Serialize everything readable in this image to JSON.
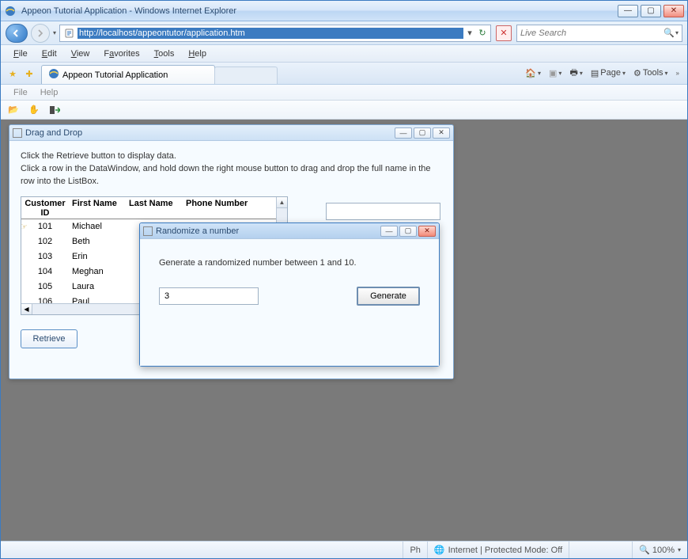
{
  "window": {
    "title": "Appeon Tutorial Application - Windows Internet Explorer"
  },
  "nav": {
    "address": "http://localhost/appeontutor/application.htm",
    "search_placeholder": "Live Search"
  },
  "ie_menu": {
    "file": "File",
    "edit": "Edit",
    "view": "View",
    "favorites": "Favorites",
    "tools": "Tools",
    "help": "Help"
  },
  "tab": {
    "label": "Appeon Tutorial Application"
  },
  "toolstrip": {
    "page": "Page",
    "tools": "Tools"
  },
  "app_menu": {
    "file": "File",
    "help": "Help"
  },
  "dragdrop": {
    "title": "Drag and Drop",
    "instr1": "Click the Retrieve button to display data.",
    "instr2": "Click a row in the DataWindow, and hold down the right mouse button to drag and drop the full name in the row into the ListBox.",
    "retrieve": "Retrieve",
    "columns": {
      "id": "Customer ID",
      "first": "First Name",
      "last": "Last Name",
      "phone": "Phone Number"
    },
    "rows": [
      {
        "id": "101",
        "first": "Michael"
      },
      {
        "id": "102",
        "first": "Beth"
      },
      {
        "id": "103",
        "first": "Erin"
      },
      {
        "id": "104",
        "first": "Meghan"
      },
      {
        "id": "105",
        "first": "Laura"
      },
      {
        "id": "106",
        "first": "Paul"
      }
    ]
  },
  "randomize": {
    "title": "Randomize a number",
    "label": "Generate a randomized number between 1 and 10.",
    "value": "3",
    "generate": "Generate"
  },
  "status": {
    "ph": "Ph",
    "mode": "Internet | Protected Mode: Off",
    "zoom": "100%"
  }
}
